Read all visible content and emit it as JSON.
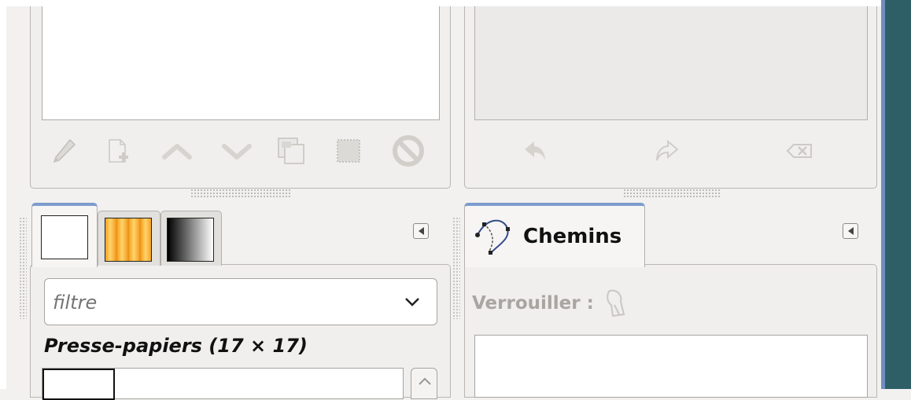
{
  "left_dock": {
    "toolbar": [
      {
        "name": "edit",
        "icon": "pencil-icon"
      },
      {
        "name": "new",
        "icon": "new-document-icon"
      },
      {
        "name": "raise",
        "icon": "chevron-up-icon"
      },
      {
        "name": "lower",
        "icon": "chevron-down-icon"
      },
      {
        "name": "duplicate",
        "icon": "duplicate-icon"
      },
      {
        "name": "to-selection",
        "icon": "selection-icon"
      },
      {
        "name": "delete",
        "icon": "delete-icon"
      }
    ],
    "tabs": [
      {
        "name": "tab-brushes",
        "swatch": "white"
      },
      {
        "name": "tab-patterns",
        "swatch": "wood"
      },
      {
        "name": "tab-gradients",
        "swatch": "gradient"
      }
    ],
    "filter": {
      "placeholder": "filtre"
    },
    "brush_title": "Presse-papiers (17 × 17)"
  },
  "right_dock": {
    "toolbar": [
      {
        "name": "undo",
        "icon": "undo-icon"
      },
      {
        "name": "redo",
        "icon": "redo-icon"
      },
      {
        "name": "clear",
        "icon": "clear-history-icon"
      }
    ],
    "tab_label": "Chemins",
    "lock_label": "Verrouiller :"
  },
  "colors": {
    "accent": "#7d9ccd",
    "sidebar": "#2f5f66",
    "disabled_text": "#a9a6a2"
  }
}
